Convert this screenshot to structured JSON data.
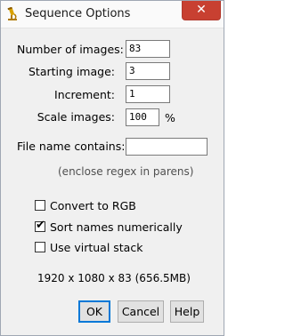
{
  "window": {
    "title": "Sequence Options",
    "close_label": "✕"
  },
  "fields": {
    "number_of_images": {
      "label": "Number of images:",
      "value": "83"
    },
    "starting_image": {
      "label": "Starting image:",
      "value": "3"
    },
    "increment": {
      "label": "Increment:",
      "value": "1"
    },
    "scale_images": {
      "label": "Scale images:",
      "value": "100",
      "unit": "%"
    },
    "file_name_contains": {
      "label": "File name contains:",
      "value": ""
    }
  },
  "hint": "(enclose regex in parens)",
  "checkboxes": [
    {
      "label": "Convert to RGB",
      "checked": false
    },
    {
      "label": "Sort names numerically",
      "checked": true
    },
    {
      "label": "Use virtual stack",
      "checked": false
    }
  ],
  "info_text": "1920 x 1080 x 83 (656.5MB)",
  "buttons": {
    "ok": "OK",
    "cancel": "Cancel",
    "help": "Help"
  },
  "colors": {
    "close_button": "#c84031",
    "default_button_border": "#0078d7"
  },
  "icons": {
    "app": "imagej-microscope-icon",
    "check": "checkmark-icon"
  }
}
